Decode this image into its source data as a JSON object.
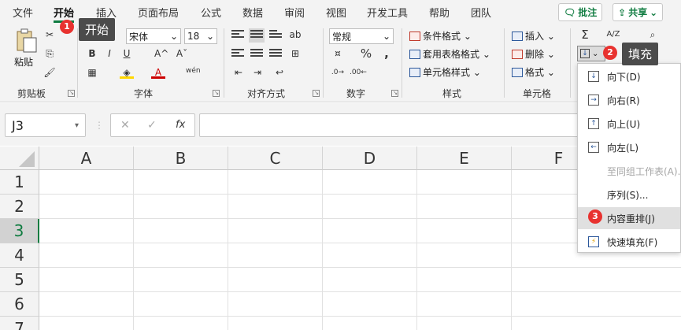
{
  "tabs": [
    "文件",
    "开始",
    "插入",
    "页面布局",
    "公式",
    "数据",
    "审阅",
    "视图",
    "开发工具",
    "帮助",
    "团队"
  ],
  "top_buttons": {
    "comment": "批注",
    "share": "共享"
  },
  "clipboard": {
    "paste": "粘贴",
    "group": "剪贴板"
  },
  "font": {
    "name": "宋体",
    "size": "18",
    "group": "字体",
    "bold": "B",
    "italic": "I",
    "underline": "U",
    "grow": "A^",
    "shrink": "Aˇ",
    "wen": "wén"
  },
  "alignment": {
    "group": "对齐方式"
  },
  "number": {
    "format": "常规",
    "group": "数字",
    "percent": "%",
    "comma": ","
  },
  "styles": {
    "conditional": "条件格式",
    "table": "套用表格格式",
    "cell": "单元格样式",
    "group": "样式"
  },
  "cells": {
    "insert": "插入",
    "delete": "删除",
    "format": "格式",
    "group": "单元格"
  },
  "editing": {
    "sum": "Σ",
    "sort": "A/Z",
    "find": "⌕"
  },
  "formula_bar": {
    "cell_ref": "J3",
    "cancel": "✕",
    "enter": "✓",
    "fx": "fx",
    "value": ""
  },
  "columns": [
    "A",
    "B",
    "C",
    "D",
    "E",
    "F"
  ],
  "rows": [
    "1",
    "2",
    "3",
    "4",
    "5",
    "6",
    "7"
  ],
  "selected_row": "3",
  "fill_menu": [
    {
      "label": "向下(D)",
      "icon": "↓",
      "disabled": false,
      "highlighted": false
    },
    {
      "label": "向右(R)",
      "icon": "→",
      "disabled": false,
      "highlighted": false
    },
    {
      "label": "向上(U)",
      "icon": "↑",
      "disabled": false,
      "highlighted": false
    },
    {
      "label": "向左(L)",
      "icon": "←",
      "disabled": false,
      "highlighted": false
    },
    {
      "label": "至同组工作表(A)...",
      "icon": "",
      "disabled": true,
      "highlighted": false
    },
    {
      "label": "序列(S)...",
      "icon": "",
      "disabled": false,
      "highlighted": false
    },
    {
      "label": "内容重排(J)",
      "icon": "",
      "disabled": false,
      "highlighted": true
    },
    {
      "label": "快速填充(F)",
      "icon": "⚡",
      "disabled": false,
      "highlighted": false
    }
  ],
  "annotations": [
    {
      "num": "1",
      "text": "开始"
    },
    {
      "num": "2",
      "text": "填充"
    },
    {
      "num": "3"
    }
  ],
  "colors": {
    "accent": "#107c41",
    "badge": "#e8322f",
    "tooltip": "#4b4b4b"
  }
}
